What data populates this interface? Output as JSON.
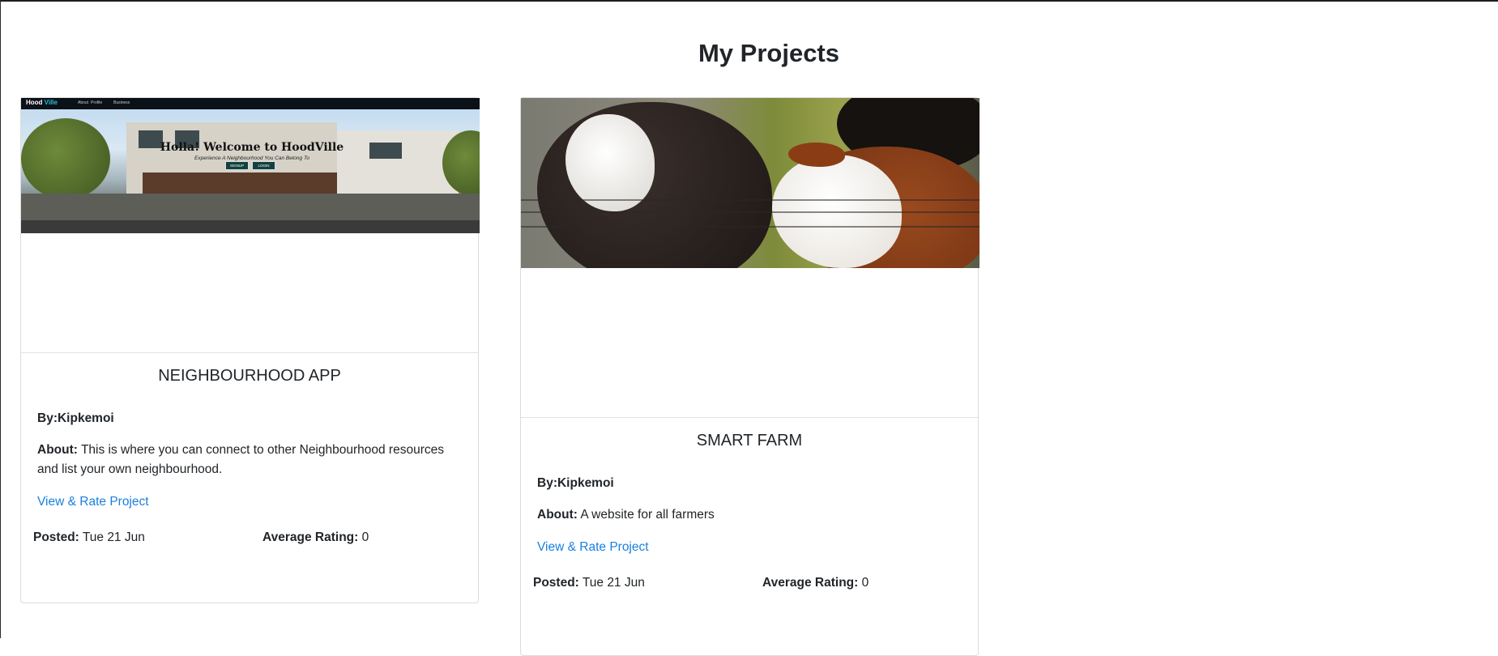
{
  "page": {
    "title": "My Projects"
  },
  "projects": [
    {
      "title": "NEIGHBOURHOOD APP",
      "by": "By:Kipkemoi",
      "about_label": "About:",
      "about_text": "This is where you can connect to other Neighbourhood resources and list your own neighbourhood.",
      "link": "View & Rate Project",
      "posted_label": "Posted:",
      "posted_value": "Tue 21 Jun",
      "rating_label": "Average Rating:",
      "rating_value": "0",
      "image": {
        "brand_a": "Hood",
        "brand_b": "Ville",
        "nav_items": [
          "About",
          "Profile",
          "Business"
        ],
        "heading": "Holla! Welcome to HoodVille",
        "tagline": "Experience A Neighbourhood You Can Belong To",
        "buttons": [
          "SIGNUP",
          "LOGIN"
        ]
      }
    },
    {
      "title": "SMART FARM",
      "by": "By:Kipkemoi",
      "about_label": "About:",
      "about_text": "A website for all farmers",
      "link": "View & Rate Project",
      "posted_label": "Posted:",
      "posted_value": "Tue 21 Jun",
      "rating_label": "Average Rating:",
      "rating_value": "0",
      "image": {
        "subject": "cows-photo"
      }
    }
  ],
  "colors": {
    "link": "#1a7fe0",
    "text": "#212529",
    "border": "#dcdcdc"
  }
}
